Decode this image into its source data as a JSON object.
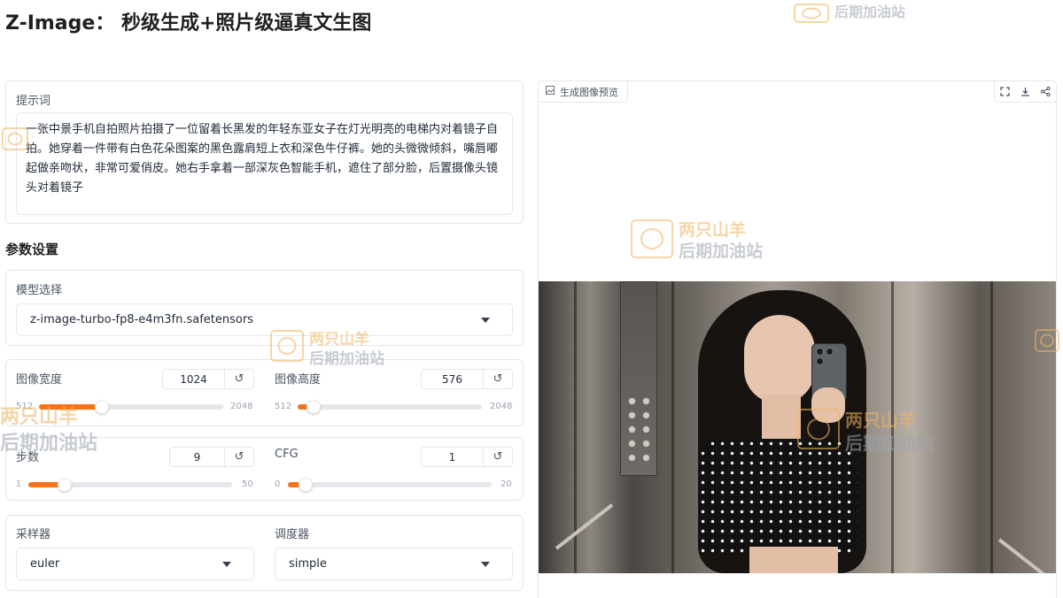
{
  "title": "Z-Image： 秒级生成+照片级逼真文生图",
  "prompt": {
    "label": "提示词",
    "value": "一张中景手机自拍照片拍摄了一位留着长黑发的年轻东亚女子在灯光明亮的电梯内对着镜子自拍。她穿着一件带有白色花朵图案的黑色露肩短上衣和深色牛仔裤。她的头微微倾斜，嘴唇嘟起做亲吻状，非常可爱俏皮。她右手拿着一部深灰色智能手机，遮住了部分脸，后置摄像头镜头对着镜子"
  },
  "params": {
    "section_title": "参数设置",
    "model": {
      "label": "模型选择",
      "value": "z-image-turbo-fp8-e4m3fn.safetensors"
    },
    "width": {
      "label": "图像宽度",
      "value": "1024",
      "min": "512",
      "max": "2048",
      "fraction": 0.34
    },
    "height": {
      "label": "图像高度",
      "value": "576",
      "min": "512",
      "max": "2048",
      "fraction": 0.04
    },
    "steps": {
      "label": "步数",
      "value": "9",
      "min": "1",
      "max": "50",
      "fraction": 0.16
    },
    "cfg": {
      "label": "CFG",
      "value": "1",
      "min": "0",
      "max": "20",
      "fraction": 0.05
    },
    "sampler": {
      "label": "采样器",
      "value": "euler"
    },
    "scheduler": {
      "label": "调度器",
      "value": "simple"
    }
  },
  "preview": {
    "tab_label": "生成图像预览",
    "image_alt": "电梯内自拍的年轻女子"
  },
  "watermark": {
    "line1": "两只山羊",
    "line2": "后期加油站",
    "top_text": "后期加油站"
  },
  "colors": {
    "accent": "#f97316",
    "watermark": "#f0b45e"
  },
  "icons": {
    "reset": "reset-icon",
    "fullscreen": "fullscreen-icon",
    "download": "download-icon",
    "share": "share-icon",
    "image": "image-icon"
  }
}
